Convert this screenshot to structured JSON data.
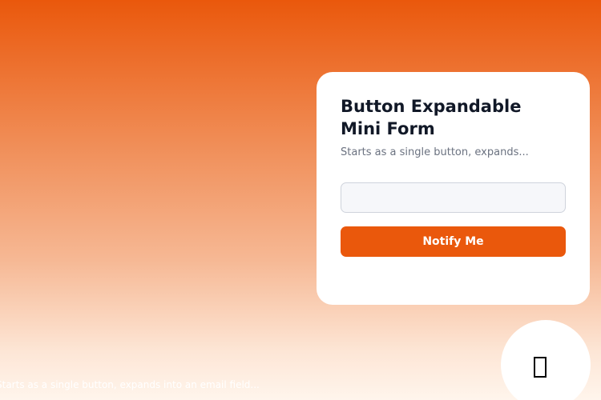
{
  "card": {
    "title": "Button Expandable Mini Form",
    "subtitle": "Starts as a single button, expands...",
    "email_input": {
      "value": "",
      "placeholder": ""
    },
    "button_label": "Notify Me"
  },
  "fab": {
    "icon": "missing-glyph-icon"
  },
  "footer": {
    "caption": "Starts as a single button, expands into an email field..."
  },
  "colors": {
    "accent": "#ea580c",
    "card_background": "#ffffff",
    "title_text": "#111827",
    "subtitle_text": "#6b7280",
    "input_background": "#f6f7fa",
    "input_border": "#cfd3dc"
  }
}
